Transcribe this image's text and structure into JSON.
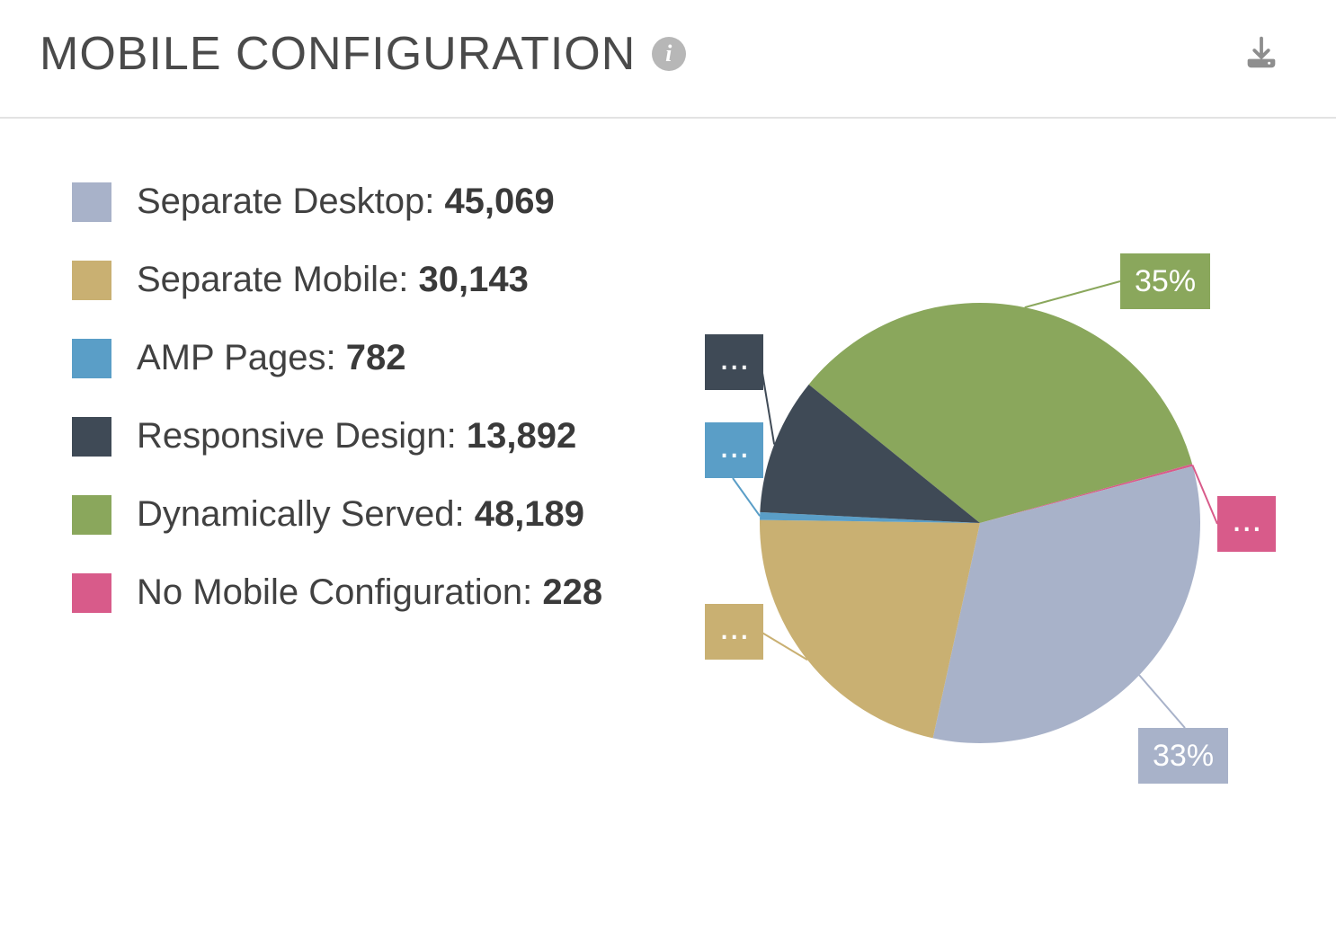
{
  "header": {
    "title": "MOBILE CONFIGURATION"
  },
  "legend": [
    {
      "label": "Separate Desktop",
      "value_text": "45,069",
      "color": "#a8b2c9"
    },
    {
      "label": "Separate Mobile",
      "value_text": "30,143",
      "color": "#c9b072"
    },
    {
      "label": "AMP Pages",
      "value_text": "782",
      "color": "#5a9ec7"
    },
    {
      "label": "Responsive Design",
      "value_text": "13,892",
      "color": "#3f4a56"
    },
    {
      "label": "Dynamically Served",
      "value_text": "48,189",
      "color": "#8aa75c"
    },
    {
      "label": "No Mobile Configuration",
      "value_text": "228",
      "color": "#d85b8a"
    }
  ],
  "callouts": {
    "dyn_served": "35%",
    "sep_desktop": "33%",
    "ellipsis": "..."
  },
  "chart_data": {
    "type": "pie",
    "title": "Mobile Configuration",
    "series": [
      {
        "name": "Separate Desktop",
        "value": 45069,
        "percent": 33,
        "color": "#a8b2c9"
      },
      {
        "name": "Separate Mobile",
        "value": 30143,
        "percent": 22,
        "color": "#c9b072"
      },
      {
        "name": "AMP Pages",
        "value": 782,
        "percent": 1,
        "color": "#5a9ec7"
      },
      {
        "name": "Responsive Design",
        "value": 13892,
        "percent": 10,
        "color": "#3f4a56"
      },
      {
        "name": "Dynamically Served",
        "value": 48189,
        "percent": 35,
        "color": "#8aa75c"
      },
      {
        "name": "No Mobile Configuration",
        "value": 228,
        "percent": 0,
        "color": "#d85b8a"
      }
    ],
    "shown_percent_labels": {
      "Dynamically Served": "35%",
      "Separate Desktop": "33%"
    }
  }
}
